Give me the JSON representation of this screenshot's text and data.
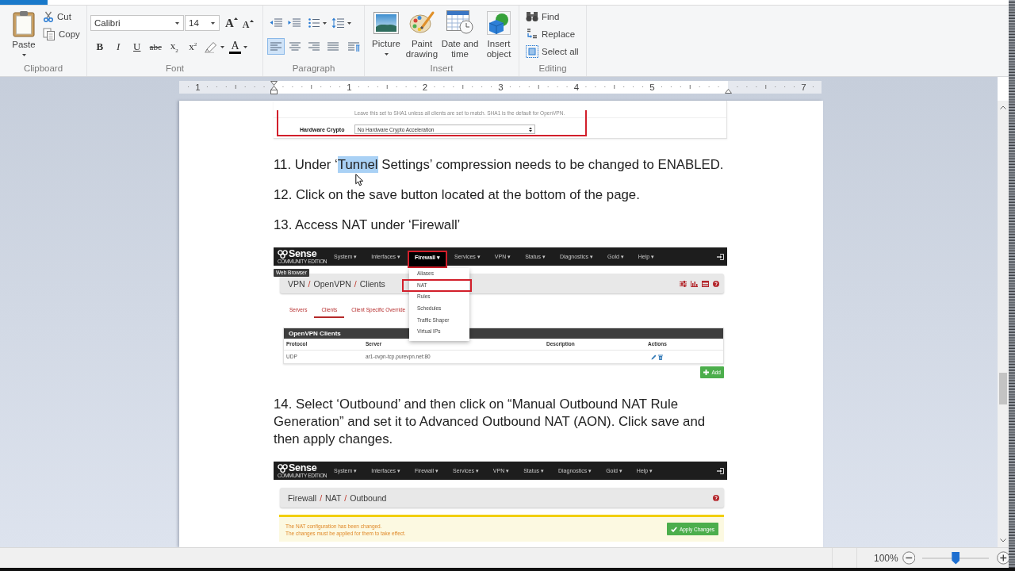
{
  "ribbon": {
    "groups": [
      {
        "kind": "clipboard",
        "label": "Clipboard",
        "paste": {
          "label": "Paste",
          "dropdown": true
        },
        "items": [
          {
            "kind": "cut",
            "label": "Cut"
          },
          {
            "kind": "copy",
            "label": "Copy"
          }
        ]
      },
      {
        "kind": "font",
        "label": "Font",
        "font_name": "Calibri",
        "font_size": "14",
        "size_buttons": [
          {
            "kind": "grow",
            "label": "A"
          },
          {
            "kind": "shrink",
            "label": "A"
          }
        ],
        "format_buttons": [
          {
            "kind": "bold",
            "label": "B"
          },
          {
            "kind": "italic",
            "label": "I"
          },
          {
            "kind": "underline",
            "label": "U"
          },
          {
            "kind": "strikethrough",
            "label": "abc"
          },
          {
            "kind": "subscript",
            "label": "x$_{2}$"
          },
          {
            "kind": "superscript",
            "label": "x$^{2}$"
          }
        ],
        "font_color": "A"
      },
      {
        "kind": "paragraph",
        "label": "Paragraph",
        "alignment": [
          {
            "kind": "left",
            "selected": true
          },
          {
            "kind": "center",
            "selected": false
          },
          {
            "kind": "right",
            "selected": false
          },
          {
            "kind": "justify",
            "selected": false
          }
        ]
      },
      {
        "kind": "insert",
        "label": "Insert",
        "items": [
          {
            "kind": "picture",
            "label": "Picture",
            "dropdown": true
          },
          {
            "kind": "paint",
            "label": "Paint drawing"
          },
          {
            "kind": "datetime",
            "label": "Date and time"
          },
          {
            "kind": "object",
            "label": "Insert object"
          }
        ]
      },
      {
        "kind": "editing",
        "label": "Editing",
        "items": [
          {
            "kind": "find",
            "label": "Find"
          },
          {
            "kind": "replace",
            "label": "Replace"
          },
          {
            "kind": "select_all",
            "label": "Select all"
          }
        ]
      }
    ]
  },
  "ruler": {
    "numbers": [
      "1",
      "1",
      "2",
      "3",
      "4",
      "5",
      "7"
    ]
  },
  "document": {
    "blocks": [
      {
        "kind": "crop",
        "note": "Leave this set to SHA1 unless all clients are set to match. SHA1 is the default for OpenVPN.",
        "field_label": "Hardware Crypto",
        "select_value": "No Hardware Crypto Acceleration",
        "highlighted": true
      },
      {
        "kind": "paragraph",
        "parts": [
          {
            "text": "11. Under ‘",
            "selected": false
          },
          {
            "text": "Tunnel",
            "selected": true
          },
          {
            "text": " Settings’ compression needs to be changed to ENABLED.",
            "selected": false
          }
        ]
      },
      {
        "kind": "paragraph",
        "parts": [
          {
            "text": "12. Click on the save button located at the bottom of the page.",
            "selected": false
          }
        ]
      },
      {
        "kind": "paragraph",
        "parts": [
          {
            "text": "13. Access NAT under ‘Firewall’",
            "selected": false
          }
        ]
      },
      {
        "kind": "screenshot",
        "logo": "Sense",
        "logo_caption": "COMMUNITY EDITION",
        "nav": [
          {
            "label": "System ▾",
            "selected": false,
            "highlighted": false
          },
          {
            "label": "Interfaces ▾",
            "selected": false,
            "highlighted": false
          },
          {
            "label": "Firewall ▾",
            "selected": true,
            "highlighted": true
          },
          {
            "label": "Services ▾",
            "selected": false,
            "highlighted": false
          },
          {
            "label": "VPN ▾",
            "selected": false,
            "highlighted": false
          },
          {
            "label": "Status ▾",
            "selected": false,
            "highlighted": false
          },
          {
            "label": "Diagnostics ▾",
            "selected": false,
            "highlighted": false
          },
          {
            "label": "Gold ▾",
            "selected": false,
            "highlighted": false
          },
          {
            "label": "Help ▾",
            "selected": false,
            "highlighted": false
          }
        ],
        "tooltip": "Web Browser",
        "breadcrumb": {
          "items": [
            "VPN",
            "OpenVPN",
            "Clients"
          ],
          "separator": "/"
        },
        "header_buttons": [
          {
            "kind": "filter"
          },
          {
            "kind": "chart"
          },
          {
            "kind": "table"
          },
          {
            "kind": "help"
          }
        ],
        "tabs": [
          {
            "label": "Servers",
            "selected": false
          },
          {
            "label": "Clients",
            "selected": true
          },
          {
            "label": "Client Specific Override",
            "selected": false
          }
        ],
        "table": {
          "title": "OpenVPN Clients",
          "columns": [
            "Protocol",
            "Server",
            "Description",
            "Actions"
          ],
          "rows": [
            {
              "protocol": "UDP",
              "server": "ar1-ovpn-tcp.purevpn.net:80",
              "actions": [
                {
                  "kind": "edit"
                },
                {
                  "kind": "delete"
                }
              ]
            }
          ]
        },
        "add_button": "Add",
        "menu": {
          "items": [
            {
              "label": "Aliases",
              "highlighted": false
            },
            {
              "label": "NAT",
              "highlighted": true
            },
            {
              "label": "Rules",
              "highlighted": false
            },
            {
              "label": "Schedules",
              "highlighted": false
            },
            {
              "label": "Traffic Shaper",
              "highlighted": false
            },
            {
              "label": "Virtual IPs",
              "highlighted": false
            }
          ]
        }
      },
      {
        "kind": "paragraph",
        "parts": [
          {
            "text": "14. Select ‘Outbound’ and then click on “Manual Outbound NAT Rule Generation” and set it to Advanced Outbound NAT (AON). Click save and then apply changes.",
            "selected": false
          }
        ]
      },
      {
        "kind": "screenshot",
        "logo": "Sense",
        "logo_caption": "COMMUNITY EDITION",
        "nav": [
          {
            "label": "System ▾",
            "selected": false,
            "highlighted": false
          },
          {
            "label": "Interfaces ▾",
            "selected": false,
            "highlighted": false
          },
          {
            "label": "Firewall ▾",
            "selected": false,
            "highlighted": false
          },
          {
            "label": "Services ▾",
            "selected": false,
            "highlighted": false
          },
          {
            "label": "VPN ▾",
            "selected": false,
            "highlighted": false
          },
          {
            "label": "Status ▾",
            "selected": false,
            "highlighted": false
          },
          {
            "label": "Diagnostics ▾",
            "selected": false,
            "highlighted": false
          },
          {
            "label": "Gold ▾",
            "selected": false,
            "highlighted": false
          },
          {
            "label": "Help ▾",
            "selected": false,
            "highlighted": false
          }
        ],
        "breadcrumb": {
          "items": [
            "Firewall",
            "NAT",
            "Outbound"
          ],
          "separator": "/"
        },
        "header_buttons": [
          {
            "kind": "help"
          }
        ],
        "alert": {
          "lines": [
            "The NAT configuration has been changed.",
            "The changes must be applied for them to take effect."
          ],
          "button": "Apply Changes"
        }
      }
    ]
  },
  "status_bar": {
    "zoom": {
      "value": "100%",
      "level": 0.5
    }
  }
}
